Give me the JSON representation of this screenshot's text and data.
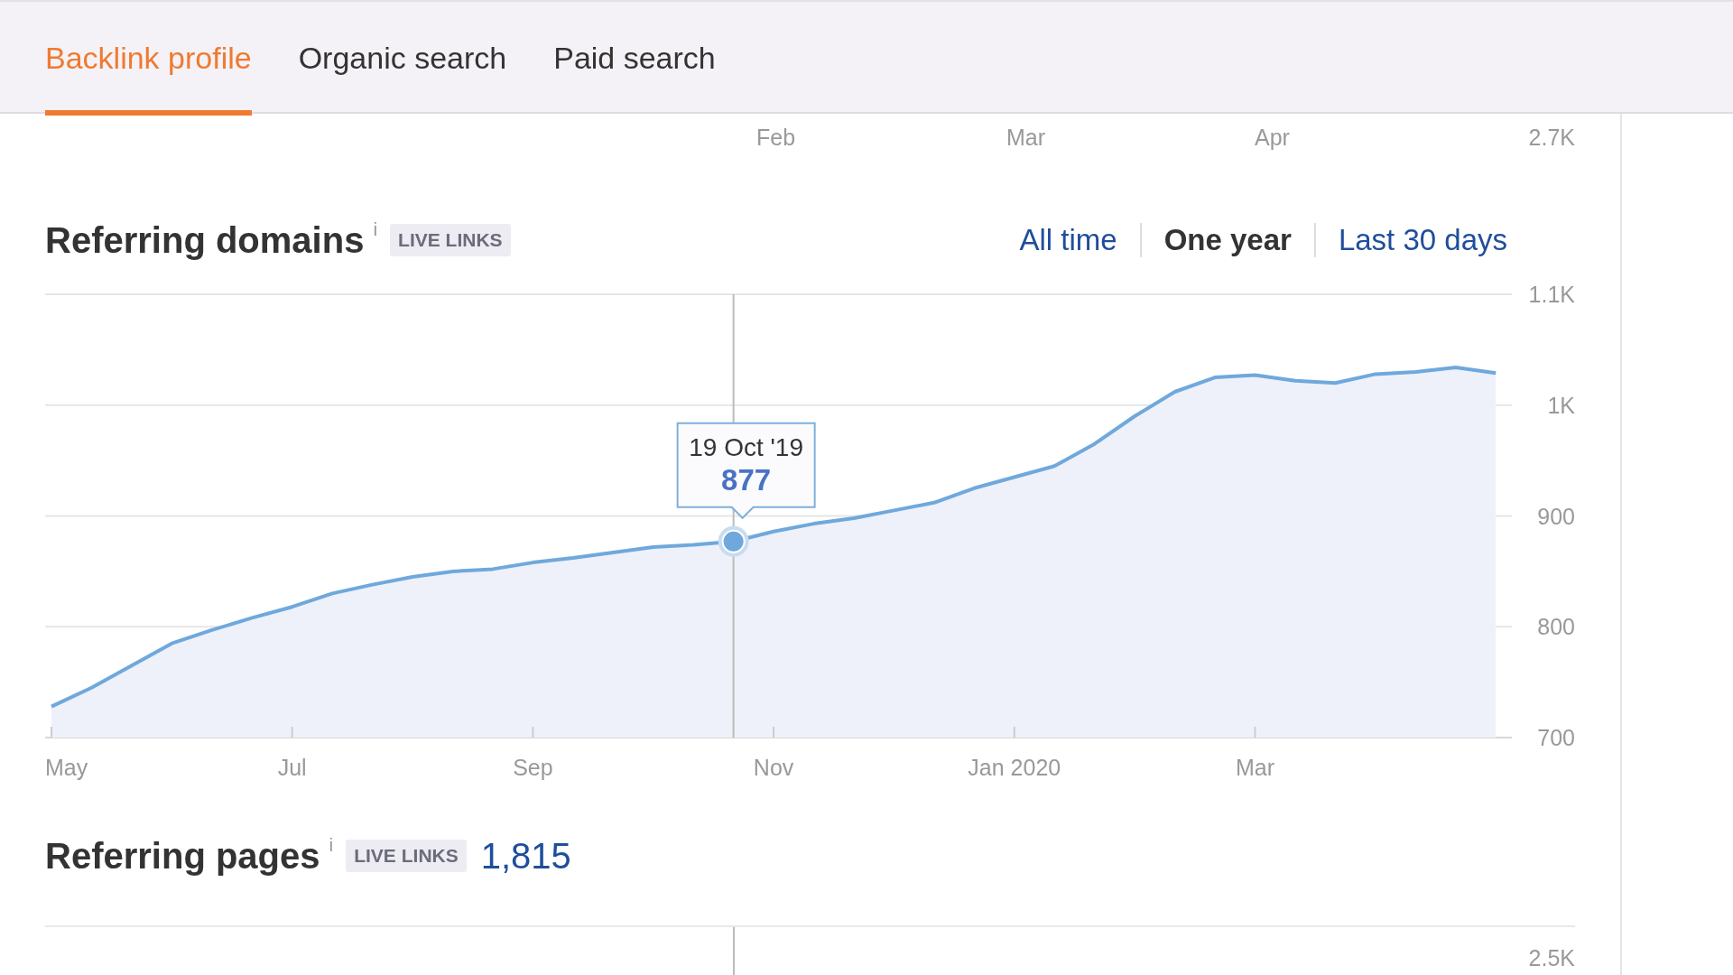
{
  "tabs": [
    {
      "label": "Backlink profile",
      "selected": true
    },
    {
      "label": "Organic search",
      "selected": false
    },
    {
      "label": "Paid search",
      "selected": false
    }
  ],
  "previous_chart_axis": {
    "x_labels": [
      "Feb",
      "Mar",
      "Apr"
    ],
    "y_label": "2.7K"
  },
  "referring_domains": {
    "title": "Referring domains",
    "info": "i",
    "badge": "LIVE LINKS",
    "time_ranges": [
      {
        "label": "All time",
        "selected": false
      },
      {
        "label": "One year",
        "selected": true
      },
      {
        "label": "Last 30 days",
        "selected": false
      }
    ],
    "chart_data": {
      "type": "area",
      "categories": [
        "May",
        null,
        null,
        null,
        null,
        null,
        "Jul",
        null,
        null,
        null,
        null,
        null,
        "Sep",
        null,
        null,
        null,
        null,
        null,
        "Nov",
        null,
        null,
        null,
        null,
        null,
        "Jan 2020",
        null,
        null,
        null,
        null,
        null,
        "Mar",
        null,
        null,
        null,
        null,
        null,
        null
      ],
      "series": [
        {
          "color": "#6fa8dc",
          "values": [
            728,
            745,
            765,
            785,
            797,
            808,
            818,
            830,
            838,
            845,
            850,
            852,
            858,
            862,
            867,
            872,
            874,
            877,
            886,
            893,
            898,
            905,
            912,
            925,
            935,
            945,
            965,
            990,
            1012,
            1025,
            1027,
            1022,
            1020,
            1028,
            1030,
            1034,
            1029
          ]
        }
      ],
      "ylim": [
        700,
        1100
      ],
      "yticks": [
        {
          "value": 700,
          "label": "700"
        },
        {
          "value": 800,
          "label": "800"
        },
        {
          "value": 900,
          "label": "900"
        },
        {
          "value": 1000,
          "label": "1K"
        },
        {
          "value": 1100,
          "label": "1.1K"
        }
      ],
      "grid": true
    },
    "tooltip": {
      "date": "19 Oct '19",
      "value": "877"
    }
  },
  "referring_pages": {
    "title": "Referring pages",
    "info": "i",
    "badge": "LIVE LINKS",
    "count": "1,815",
    "axis_label": "2.5K"
  }
}
